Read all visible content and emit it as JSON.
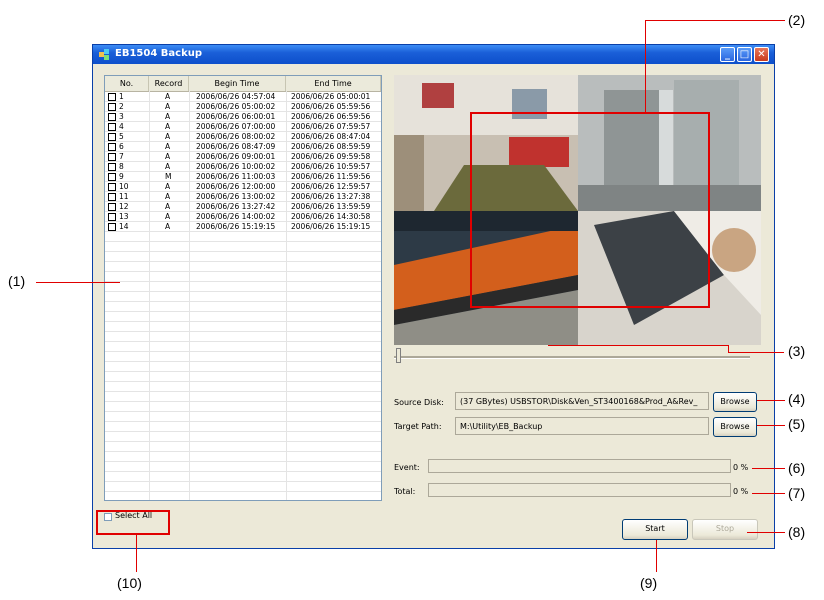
{
  "window": {
    "title": "EB1504 Backup"
  },
  "table": {
    "headers": [
      "No.",
      "Record",
      "Begin Time",
      "End Time"
    ],
    "rows": [
      {
        "no": "1",
        "record": "A",
        "begin": "2006/06/26 04:57:04",
        "end": "2006/06/26 05:00:01"
      },
      {
        "no": "2",
        "record": "A",
        "begin": "2006/06/26 05:00:02",
        "end": "2006/06/26 05:59:56"
      },
      {
        "no": "3",
        "record": "A",
        "begin": "2006/06/26 06:00:01",
        "end": "2006/06/26 06:59:56"
      },
      {
        "no": "4",
        "record": "A",
        "begin": "2006/06/26 07:00:00",
        "end": "2006/06/26 07:59:57"
      },
      {
        "no": "5",
        "record": "A",
        "begin": "2006/06/26 08:00:02",
        "end": "2006/06/26 08:47:04"
      },
      {
        "no": "6",
        "record": "A",
        "begin": "2006/06/26 08:47:09",
        "end": "2006/06/26 08:59:59"
      },
      {
        "no": "7",
        "record": "A",
        "begin": "2006/06/26 09:00:01",
        "end": "2006/06/26 09:59:58"
      },
      {
        "no": "8",
        "record": "A",
        "begin": "2006/06/26 10:00:02",
        "end": "2006/06/26 10:59:57"
      },
      {
        "no": "9",
        "record": "M",
        "begin": "2006/06/26 11:00:03",
        "end": "2006/06/26 11:59:56"
      },
      {
        "no": "10",
        "record": "A",
        "begin": "2006/06/26 12:00:00",
        "end": "2006/06/26 12:59:57"
      },
      {
        "no": "11",
        "record": "A",
        "begin": "2006/06/26 13:00:02",
        "end": "2006/06/26 13:27:38"
      },
      {
        "no": "12",
        "record": "A",
        "begin": "2006/06/26 13:27:42",
        "end": "2006/06/26 13:59:59"
      },
      {
        "no": "13",
        "record": "A",
        "begin": "2006/06/26 14:00:02",
        "end": "2006/06/26 14:30:58"
      },
      {
        "no": "14",
        "record": "A",
        "begin": "2006/06/26 15:19:15",
        "end": "2006/06/26 15:19:15"
      }
    ]
  },
  "select_all": {
    "label": "Select All",
    "checked": false
  },
  "source_disk": {
    "label": "Source Disk:",
    "value": "(37 GBytes) USBSTOR\\Disk&Ven_ST3400168&Prod_A&Rev_",
    "browse": "Browse"
  },
  "target_path": {
    "label": "Target Path:",
    "value": "M:\\Utility\\EB_Backup",
    "browse": "Browse"
  },
  "event": {
    "label": "Event:",
    "percent": "0 %"
  },
  "total": {
    "label": "Total:",
    "percent": "0 %"
  },
  "buttons": {
    "start": "Start",
    "stop": "Stop"
  },
  "callouts": {
    "c1": "(1)",
    "c2": "(2)",
    "c3": "(3)",
    "c4": "(4)",
    "c5": "(5)",
    "c6": "(6)",
    "c7": "(7)",
    "c8": "(8)",
    "c9": "(9)",
    "c10": "(10)"
  },
  "colors": {
    "annotation": "#e00000",
    "titlebar": "#1a5fd8",
    "window_bg": "#ece9d8"
  }
}
